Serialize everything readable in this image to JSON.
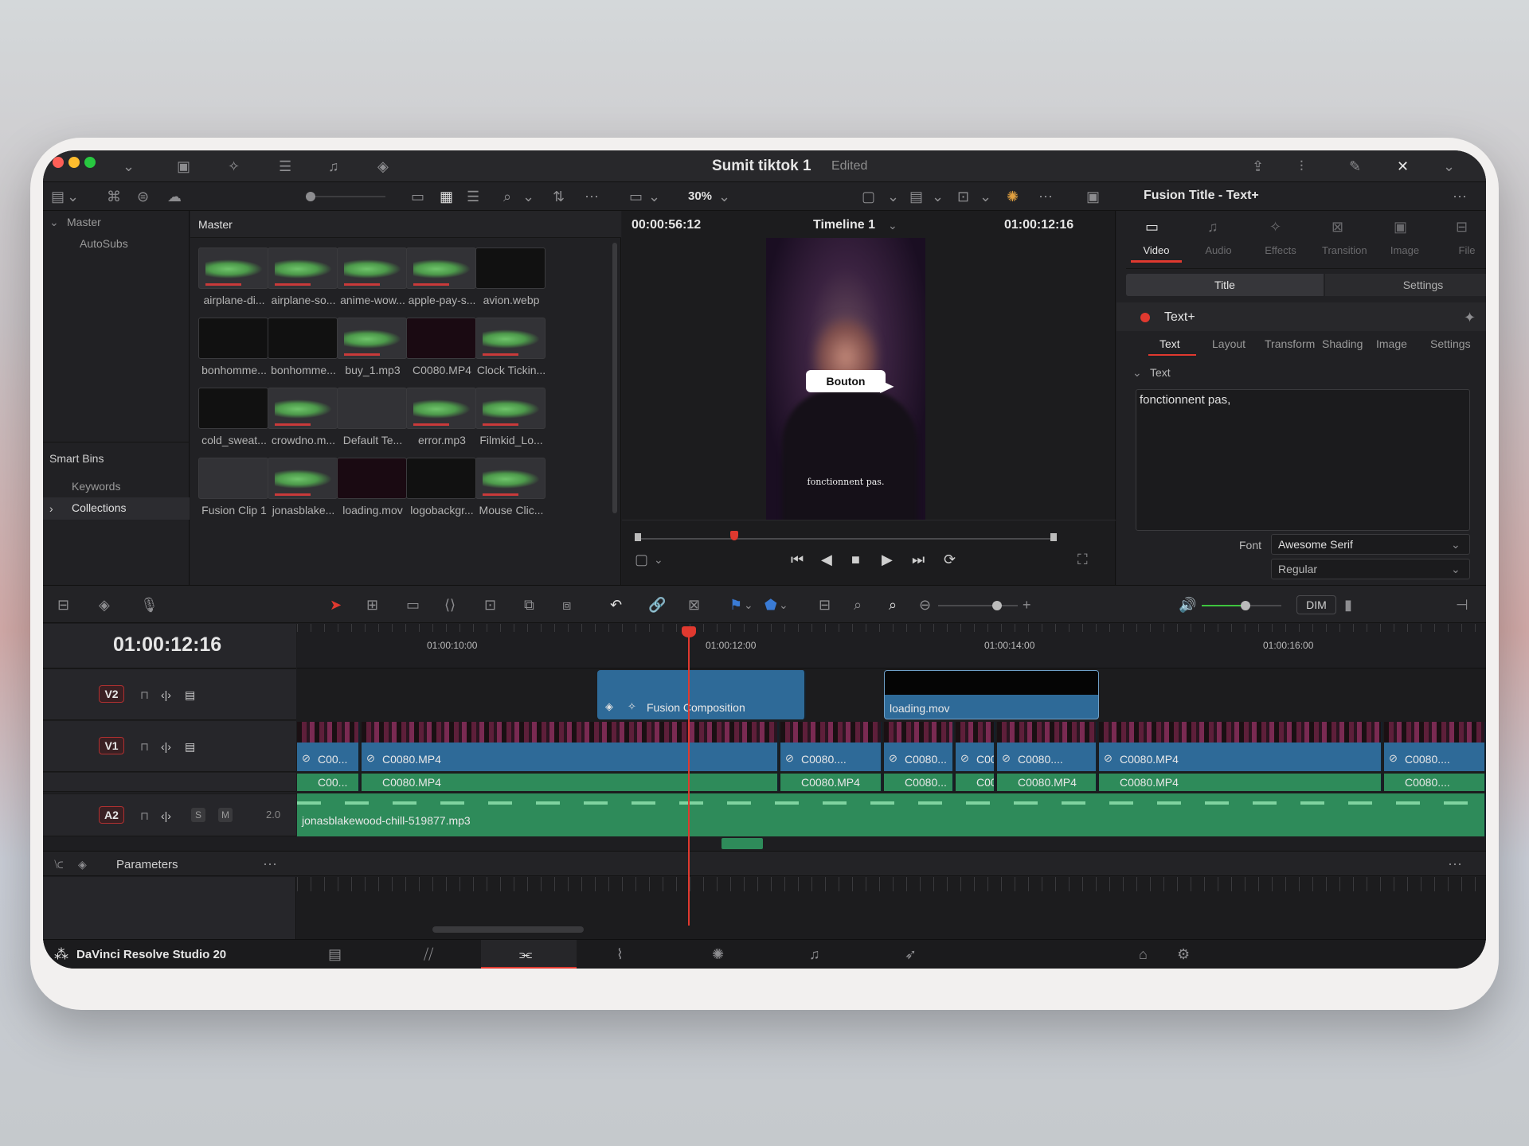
{
  "window": {
    "title": "Sumit tiktok 1",
    "status": "Edited"
  },
  "media_pool": {
    "tree": {
      "root": "Master",
      "child": "AutoSubs"
    },
    "smart_bins": {
      "header": "Smart Bins",
      "items": [
        "Keywords",
        "Collections"
      ]
    },
    "bin_title": "Master",
    "clips": [
      {
        "label": "airplane-di...",
        "kind": "audio"
      },
      {
        "label": "airplane-so...",
        "kind": "audio"
      },
      {
        "label": "anime-wow...",
        "kind": "audio"
      },
      {
        "label": "apple-pay-s...",
        "kind": "audio"
      },
      {
        "label": "avion.webp",
        "kind": "image"
      },
      {
        "label": "bonhomme...",
        "kind": "image"
      },
      {
        "label": "bonhomme...",
        "kind": "image"
      },
      {
        "label": "buy_1.mp3",
        "kind": "audio"
      },
      {
        "label": "C0080.MP4",
        "kind": "video"
      },
      {
        "label": "Clock Tickin...",
        "kind": "audio"
      },
      {
        "label": "cold_sweat...",
        "kind": "image"
      },
      {
        "label": "crowdno.m...",
        "kind": "audio"
      },
      {
        "label": "Default Te...",
        "kind": "title"
      },
      {
        "label": "error.mp3",
        "kind": "audio"
      },
      {
        "label": "Filmkid_Lo...",
        "kind": "audio"
      },
      {
        "label": "Fusion Clip 1",
        "kind": "fusion"
      },
      {
        "label": "jonasblake...",
        "kind": "audio"
      },
      {
        "label": "loading.mov",
        "kind": "video"
      },
      {
        "label": "logobackgr...",
        "kind": "image"
      },
      {
        "label": "Mouse Clic...",
        "kind": "audio"
      }
    ]
  },
  "viewer": {
    "zoom": "30%",
    "timecode_left": "00:00:56:12",
    "timeline_name": "Timeline 1",
    "timecode_right": "01:00:12:16",
    "button_overlay": "Bouton",
    "subtitle": "fonctionnent pas."
  },
  "inspector": {
    "title": "Fusion Title - Text+",
    "tabs": [
      "Video",
      "Audio",
      "Effects",
      "Transition",
      "Image",
      "File"
    ],
    "subtabs": [
      "Title",
      "Settings"
    ],
    "node": "Text+",
    "text_tabs": [
      "Text",
      "Layout",
      "Transform",
      "Shading",
      "Image",
      "Settings"
    ],
    "section": "Text",
    "text_value": "fonctionnent pas,",
    "font_label": "Font",
    "font_value": "Awesome Serif",
    "style_value": "Regular"
  },
  "timeline": {
    "timecode": "01:00:12:16",
    "ruler": [
      "01:00:10:00",
      "01:00:12:00",
      "01:00:14:00",
      "01:00:16:00"
    ],
    "dim": "DIM",
    "tracks": [
      {
        "name": "V2"
      },
      {
        "name": "V1"
      },
      {
        "name": "A2",
        "level": "2.0",
        "s": "S",
        "m": "M"
      }
    ],
    "v2_clips": [
      "Fusion Composition",
      "loading.mov"
    ],
    "v1_clips": [
      "C00...",
      "C0080.MP4",
      "C0080....",
      "C0080...",
      "C00...",
      "C0080....",
      "C0080.MP4",
      "C0080...."
    ],
    "a1_clips": [
      "C00...",
      "C0080.MP4",
      "C0080.MP4",
      "C0080...",
      "C00...",
      "C0080.MP4",
      "C0080.MP4",
      "C0080...."
    ],
    "a2_clip": "jonasblakewood-chill-519877.mp3",
    "params_label": "Parameters"
  },
  "footer": {
    "app_name": "DaVinci Resolve Studio 20"
  },
  "colors": {
    "accent": "#e0392f",
    "video_clip": "#2e6a98",
    "audio_clip": "#2e8b5a",
    "playhead": "#e0392f"
  }
}
